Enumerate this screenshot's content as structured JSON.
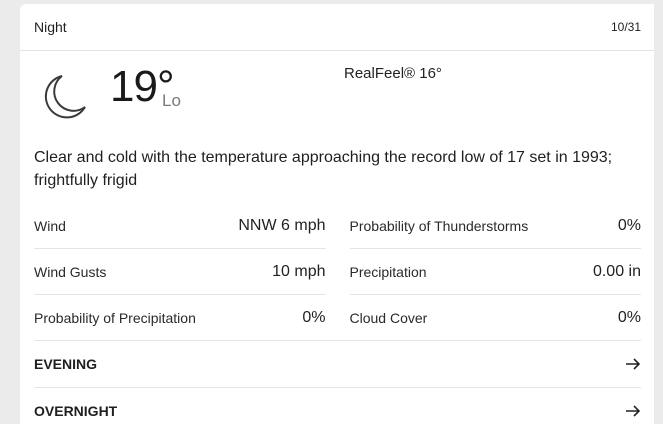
{
  "header": {
    "title": "Night",
    "date": "10/31"
  },
  "current": {
    "icon": "moon-icon",
    "temperature": "19°",
    "lo_label": "Lo",
    "realfeel": "RealFeel® 16°"
  },
  "phrase": "Clear and cold with the temperature approaching the record low of 17 set in 1993; frightfully frigid",
  "details": {
    "left": [
      {
        "label": "Wind",
        "value": "NNW 6 mph"
      },
      {
        "label": "Wind Gusts",
        "value": "10 mph"
      },
      {
        "label": "Probability of Precipitation",
        "value": "0%"
      }
    ],
    "right": [
      {
        "label": "Probability of Thunderstorms",
        "value": "0%"
      },
      {
        "label": "Precipitation",
        "value": "0.00 in"
      },
      {
        "label": "Cloud Cover",
        "value": "0%"
      }
    ]
  },
  "sections": [
    {
      "label": "EVENING",
      "icon": "arrow-right-icon"
    },
    {
      "label": "OVERNIGHT",
      "icon": "arrow-right-icon"
    }
  ]
}
